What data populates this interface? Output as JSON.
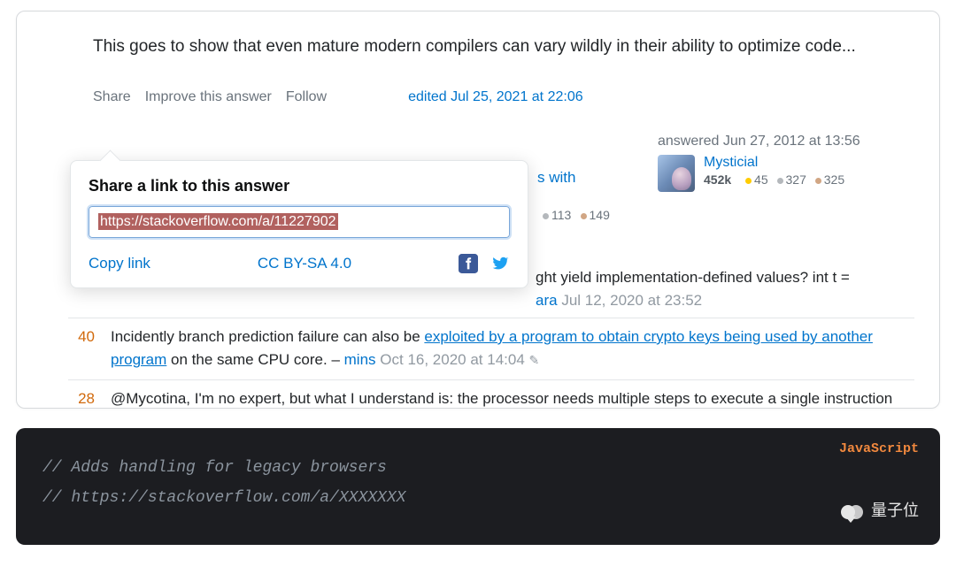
{
  "answer": {
    "text": "This goes to show that even mature modern compilers can vary wildly in their ability to optimize code..."
  },
  "actions": {
    "share": "Share",
    "improve": "Improve this answer",
    "follow": "Follow"
  },
  "edited": {
    "prefix": "edited ",
    "time": "Jul 25, 2021 at 22:06"
  },
  "owner": {
    "prefix": "answered ",
    "time": "Jun 27, 2012 at 13:56",
    "name": "Mysticial",
    "rep": "452k",
    "gold": "45",
    "silver": "327",
    "bronze": "325"
  },
  "share_popup": {
    "title": "Share a link to this answer",
    "url": "https://stackoverflow.com/a/11227902",
    "copy": "Copy link",
    "license": "CC BY-SA 4.0"
  },
  "peek": {
    "with": "s with",
    "silver": "113",
    "bronze": "149"
  },
  "top_comment": {
    "tail": "ght yield implementation-defined values? int t =",
    "author": "ara",
    "time": "Jul 12, 2020 at 23:52"
  },
  "comments": [
    {
      "votes": "40",
      "body_pre": "Incidently branch prediction failure can also be ",
      "link": "exploited by a program to obtain crypto keys being used by another program",
      "body_post": " on the same CPU core. – ",
      "author": "mins",
      "time": "Oct 16, 2020 at 14:04"
    },
    {
      "votes": "28",
      "body_pre": "@Mycotina, I'm no expert, but what I understand is: the processor needs multiple steps to execute a single instruction (fetching, decoding, etc) -- this is called \"instruction pipelining\" -- so, as an optimization",
      "link": "",
      "body_post": "",
      "author": "",
      "time": ""
    }
  ],
  "code": {
    "lang": "JavaScript",
    "line1": "// Adds handling for legacy browsers",
    "line2": "// https://stackoverflow.com/a/XXXXXXX"
  },
  "watermark": "量子位"
}
